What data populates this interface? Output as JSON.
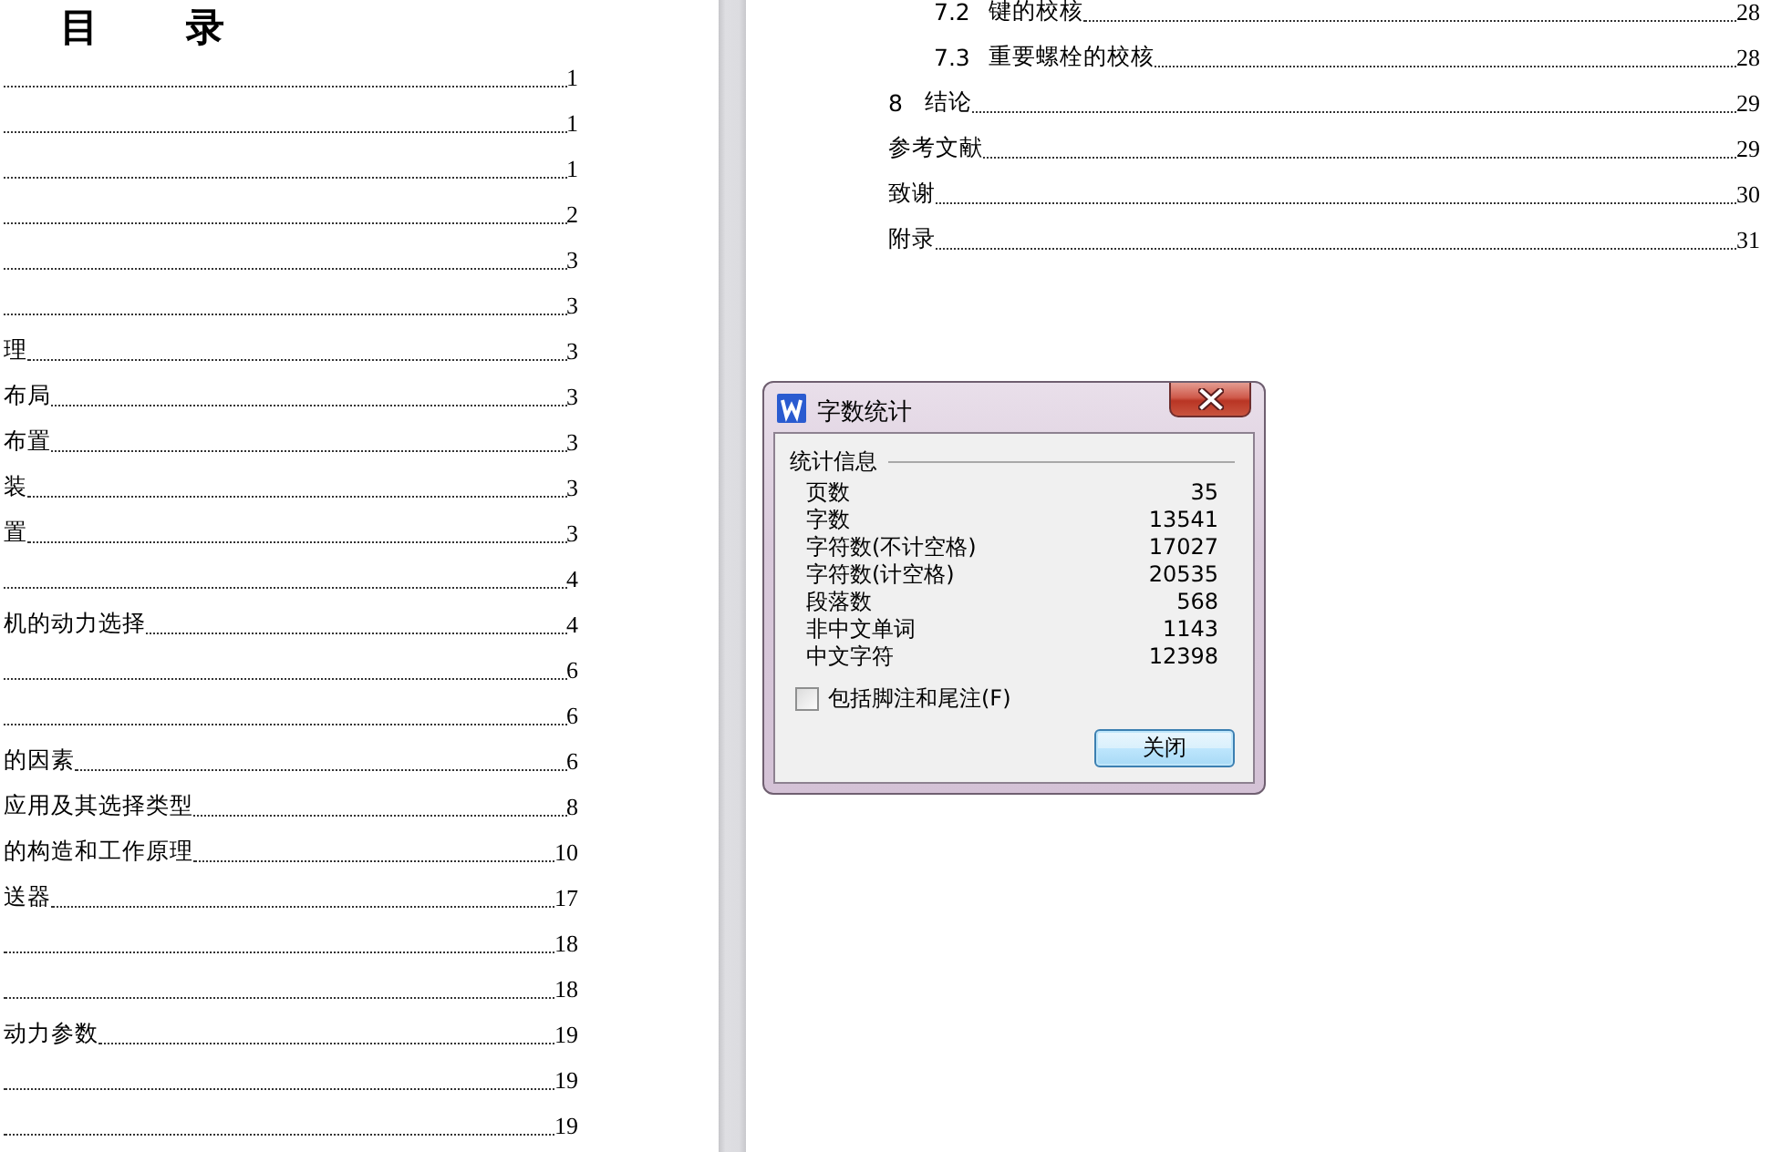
{
  "left_page": {
    "title": "目　　录",
    "entries": [
      {
        "page": "1"
      },
      {
        "page": "1"
      },
      {
        "page": "1"
      },
      {
        "page": "2"
      },
      {
        "page": "3"
      },
      {
        "page": "3"
      },
      {
        "text": "理",
        "page": "3"
      },
      {
        "text": "布局",
        "page": "3"
      },
      {
        "text": "布置",
        "page": "3"
      },
      {
        "text": "装",
        "page": "3"
      },
      {
        "text": "置",
        "page": "3"
      },
      {
        "page": "4"
      },
      {
        "text": "机的动力选择",
        "page": "4"
      },
      {
        "page": "6"
      },
      {
        "page": "6"
      },
      {
        "text": "的因素",
        "page": "6"
      },
      {
        "text": "应用及其选择类型",
        "page": "8"
      },
      {
        "text": "的构造和工作原理",
        "page": "10"
      },
      {
        "text": "送器",
        "page": "17"
      },
      {
        "page": "18"
      },
      {
        "page": "18"
      },
      {
        "text": "动力参数",
        "page": "19"
      },
      {
        "page": "19"
      },
      {
        "page": "19"
      }
    ]
  },
  "right_page": {
    "entries": [
      {
        "children": [
          {
            "number": "7.2",
            "text": "键的校核",
            "page": "28"
          },
          {
            "number": "7.3",
            "text": "重要螺栓的校核",
            "page": "28"
          }
        ]
      },
      {
        "number": "8",
        "text": "结论",
        "page": "29"
      },
      {
        "text": "参考文献",
        "page": "29"
      },
      {
        "text": "致谢",
        "page": "30"
      },
      {
        "text": "附录",
        "page": "31"
      }
    ]
  },
  "dialog": {
    "title": "字数统计",
    "group": "统计信息",
    "stats": [
      {
        "label": "页数",
        "value": "35"
      },
      {
        "label": "字数",
        "value": "13541"
      },
      {
        "label": "字符数(不计空格)",
        "value": "17027"
      },
      {
        "label": "字符数(计空格)",
        "value": "20535"
      },
      {
        "label": "段落数",
        "value": "568"
      },
      {
        "label": "非中文单词",
        "value": "1143"
      },
      {
        "label": "中文字符",
        "value": "12398"
      }
    ],
    "checkbox": {
      "label": "包括脚注和尾注(F)",
      "checked": false
    },
    "button": {
      "label": "关闭",
      "focused": true
    }
  }
}
